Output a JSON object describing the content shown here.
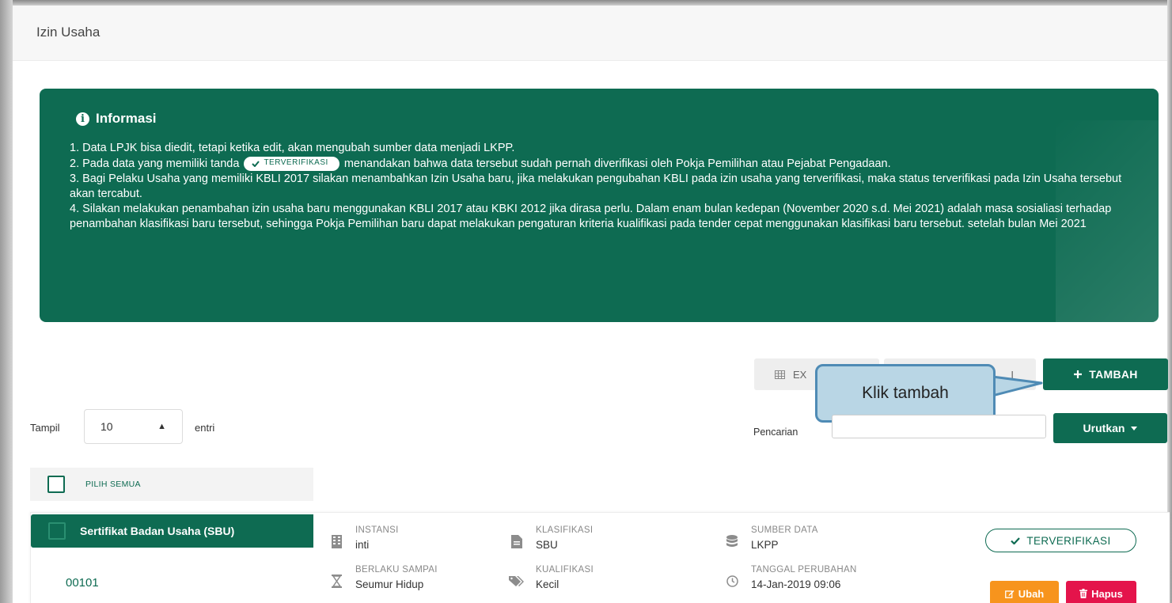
{
  "header": {
    "title": "Izin Usaha"
  },
  "info": {
    "title": "Informasi",
    "items": [
      "1. Data LPJK bisa diedit, tetapi ketika edit, akan mengubah sumber data menjadi LKPP.",
      {
        "before": "2. Pada data yang memiliki tanda",
        "badge": "TERVERIFIKASI",
        "after": "menandakan bahwa data tersebut sudah pernah diverifikasi oleh Pokja Pemilihan atau Pejabat Pengadaan."
      },
      "3. Bagi Pelaku Usaha yang memiliki KBLI 2017 silakan menambahkan Izin Usaha baru, jika melakukan pengubahan KBLI pada izin usaha yang terverifikasi, maka status terverifikasi pada Izin Usaha tersebut akan tercabut.",
      "4. Silakan melakukan penambahan izin usaha baru menggunakan KBLI 2017 atau KBKI 2012 jika dirasa perlu. Dalam enam bulan kedepan (November 2020 s.d. Mei 2021) adalah masa sosialiasi terhadap penambahan klasifikasi baru tersebut, sehingga Pokja Pemilihan baru dapat melakukan pengaturan kriteria kualifikasi pada tender cepat menggunakan klasifikasi baru tersebut. setelah bulan Mei 2021"
    ]
  },
  "toolbar": {
    "export_label": "EX",
    "import_label": "I",
    "tambah_label": "TAMBAH",
    "callout_text": "Klik tambah"
  },
  "table_controls": {
    "show_label": "Tampil",
    "entries_value": "10",
    "entries_suffix": "entri",
    "search_label": "Pencarian",
    "search_value": "",
    "sort_label": "Urutkan"
  },
  "select_all_label": "PILIH SEMUA",
  "records": [
    {
      "type": "Sertifikat Badan Usaha (SBU)",
      "number": "00101",
      "instansi_label": "INSTANSI",
      "instansi": "inti",
      "klasifikasi_label": "KLASIFIKASI",
      "klasifikasi": "SBU",
      "sumber_label": "SUMBER DATA",
      "sumber": "LKPP",
      "berlaku_label": "BERLAKU SAMPAI",
      "berlaku": "Seumur Hidup",
      "kualifikasi_label": "KUALIFIKASI",
      "kualifikasi": "Kecil",
      "tanggal_label": "TANGGAL PERUBAHAN",
      "tanggal": "14-Jan-2019 09:06",
      "status": "TERVERIFIKASI",
      "edit_label": "Ubah",
      "delete_label": "Hapus"
    }
  ],
  "colors": {
    "primary": "#0e6b52",
    "edit": "#f7941d",
    "delete": "#e4144b",
    "callout_fill": "#b9d6e5",
    "callout_border": "#4f8bb5"
  }
}
